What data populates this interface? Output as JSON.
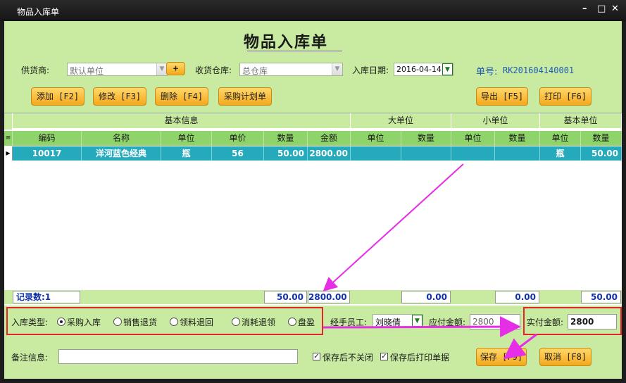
{
  "window": {
    "title": "物品入库单",
    "controls": [
      "–",
      "□",
      "✕"
    ]
  },
  "form": {
    "title": "物品入库单"
  },
  "header": {
    "supplier_label": "供货商:",
    "supplier_value": "默认单位",
    "add_button": "+",
    "warehouse_label": "收货仓库:",
    "warehouse_value": "总仓库",
    "date_label": "入库日期:",
    "date_value": "2016-04-14",
    "order_no_label": "单号:",
    "order_no_value": "RK201604140001"
  },
  "toolbar": {
    "add": "添加 [F2]",
    "edit": "修改 [F3]",
    "delete": "删除 [F4]",
    "purchase_plan": "采购计划单",
    "export": "导出 [F5]",
    "print": "打印 [F6]"
  },
  "grid": {
    "groups": [
      "基本信息",
      "大单位",
      "小单位",
      "基本单位"
    ],
    "columns": [
      "编码",
      "名称",
      "单位",
      "单价",
      "数量",
      "金额",
      "单位",
      "数量",
      "单位",
      "数量",
      "单位",
      "数量"
    ],
    "rows": [
      {
        "code": "10017",
        "name": "洋河蓝色经典",
        "unit": "瓶",
        "price": "56",
        "qty": "50.00",
        "amount": "2800.00",
        "big_unit": "",
        "big_qty": "",
        "small_unit": "",
        "small_qty": "",
        "base_unit": "瓶",
        "base_qty": "50.00"
      }
    ],
    "footer": {
      "record_count": "记录数:1",
      "qty_total": "50.00",
      "amount_total": "2800.00",
      "big_total": "0.00",
      "small_total": "0.00",
      "base_total": "50.00"
    }
  },
  "bottom": {
    "type_label": "入库类型:",
    "types": [
      "采购入库",
      "销售退货",
      "领料退回",
      "消耗退领",
      "盘盈"
    ],
    "selected_type": "采购入库",
    "handler_label": "经手员工:",
    "handler_value": "刘晓倩",
    "payable_label": "应付金额:",
    "payable_value": "2800",
    "paid_label": "实付金额:",
    "paid_value": "2800",
    "remark_label": "备注信息:",
    "remark_value": "",
    "chk_keep_open": "保存后不关闭",
    "chk_print": "保存后打印单据",
    "save": "保存 [F9]",
    "cancel": "取消 [F8]"
  },
  "colors": {
    "panel": "#c8eba1",
    "header_row": "#8ed46a",
    "selected_row": "#25aabb",
    "button": "#f4a81c",
    "annotation_arrow": "#e62ee6",
    "highlight_box": "#e0262a",
    "order_no": "#1f5ab6"
  }
}
